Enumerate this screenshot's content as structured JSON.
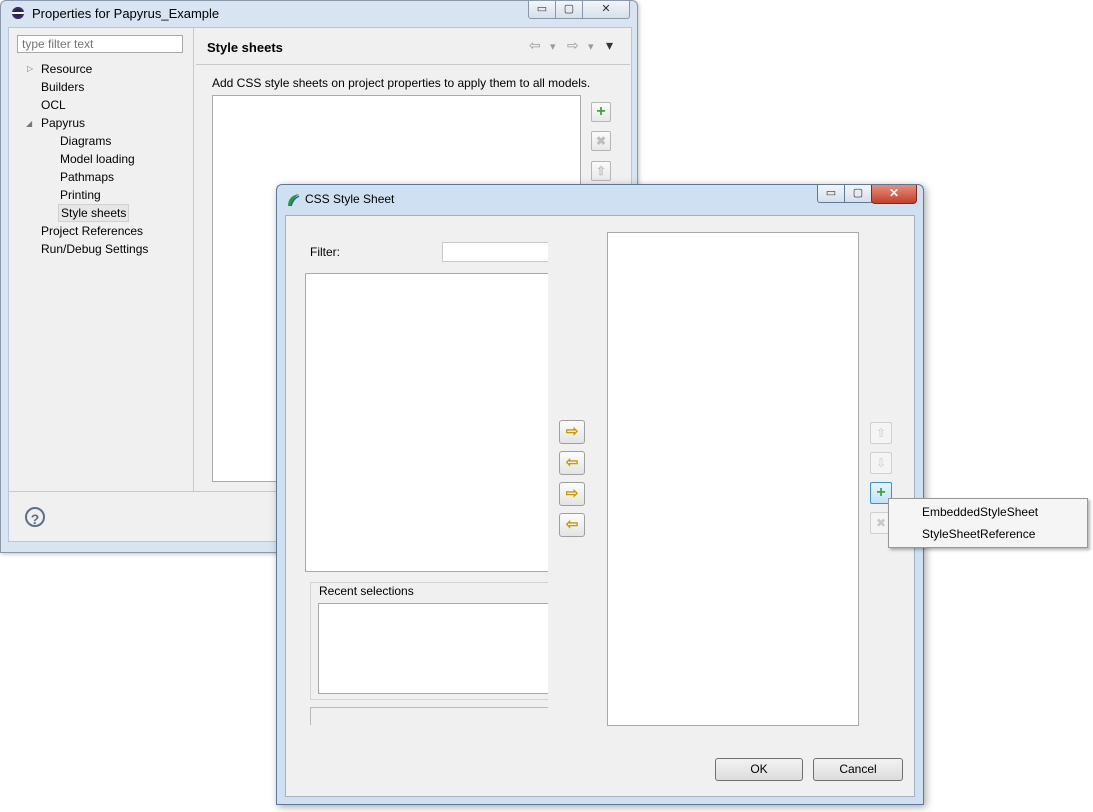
{
  "properties_window": {
    "title": "Properties for Papyrus_Example",
    "controls": {
      "minimize": "▭",
      "maximize": "▢",
      "close": "✕"
    },
    "filter_placeholder": "type filter text",
    "tree": [
      {
        "label": "Resource",
        "arrow": "▷"
      },
      {
        "label": "Builders"
      },
      {
        "label": "OCL"
      },
      {
        "label": "Papyrus",
        "arrow": "◢"
      },
      {
        "label": "Diagrams"
      },
      {
        "label": "Model loading"
      },
      {
        "label": "Pathmaps"
      },
      {
        "label": "Printing"
      },
      {
        "label": "Style sheets"
      },
      {
        "label": "Project References"
      },
      {
        "label": "Run/Debug Settings"
      }
    ],
    "page_title": "Style sheets",
    "page_description": "Add CSS style sheets on project properties to apply them to all models.",
    "nav": {
      "back": "⇦",
      "forward": "⇨",
      "dropdown": "▾"
    },
    "help": "?"
  },
  "css_dialog": {
    "title": "CSS Style Sheet",
    "filter_label": "Filter:",
    "recent_label": "Recent selections",
    "move_buttons": [
      "⇨",
      "⇦",
      "⇨",
      "⇦"
    ],
    "order_buttons": {
      "up": "⇧",
      "down": "⇩",
      "add": "+",
      "remove": "✖"
    },
    "ok_label": "OK",
    "cancel_label": "Cancel",
    "controls": {
      "minimize": "▭",
      "maximize": "▢",
      "close": "✕"
    }
  },
  "popup_menu": {
    "items": [
      "EmbeddedStyleSheet",
      "StyleSheetReference"
    ]
  }
}
